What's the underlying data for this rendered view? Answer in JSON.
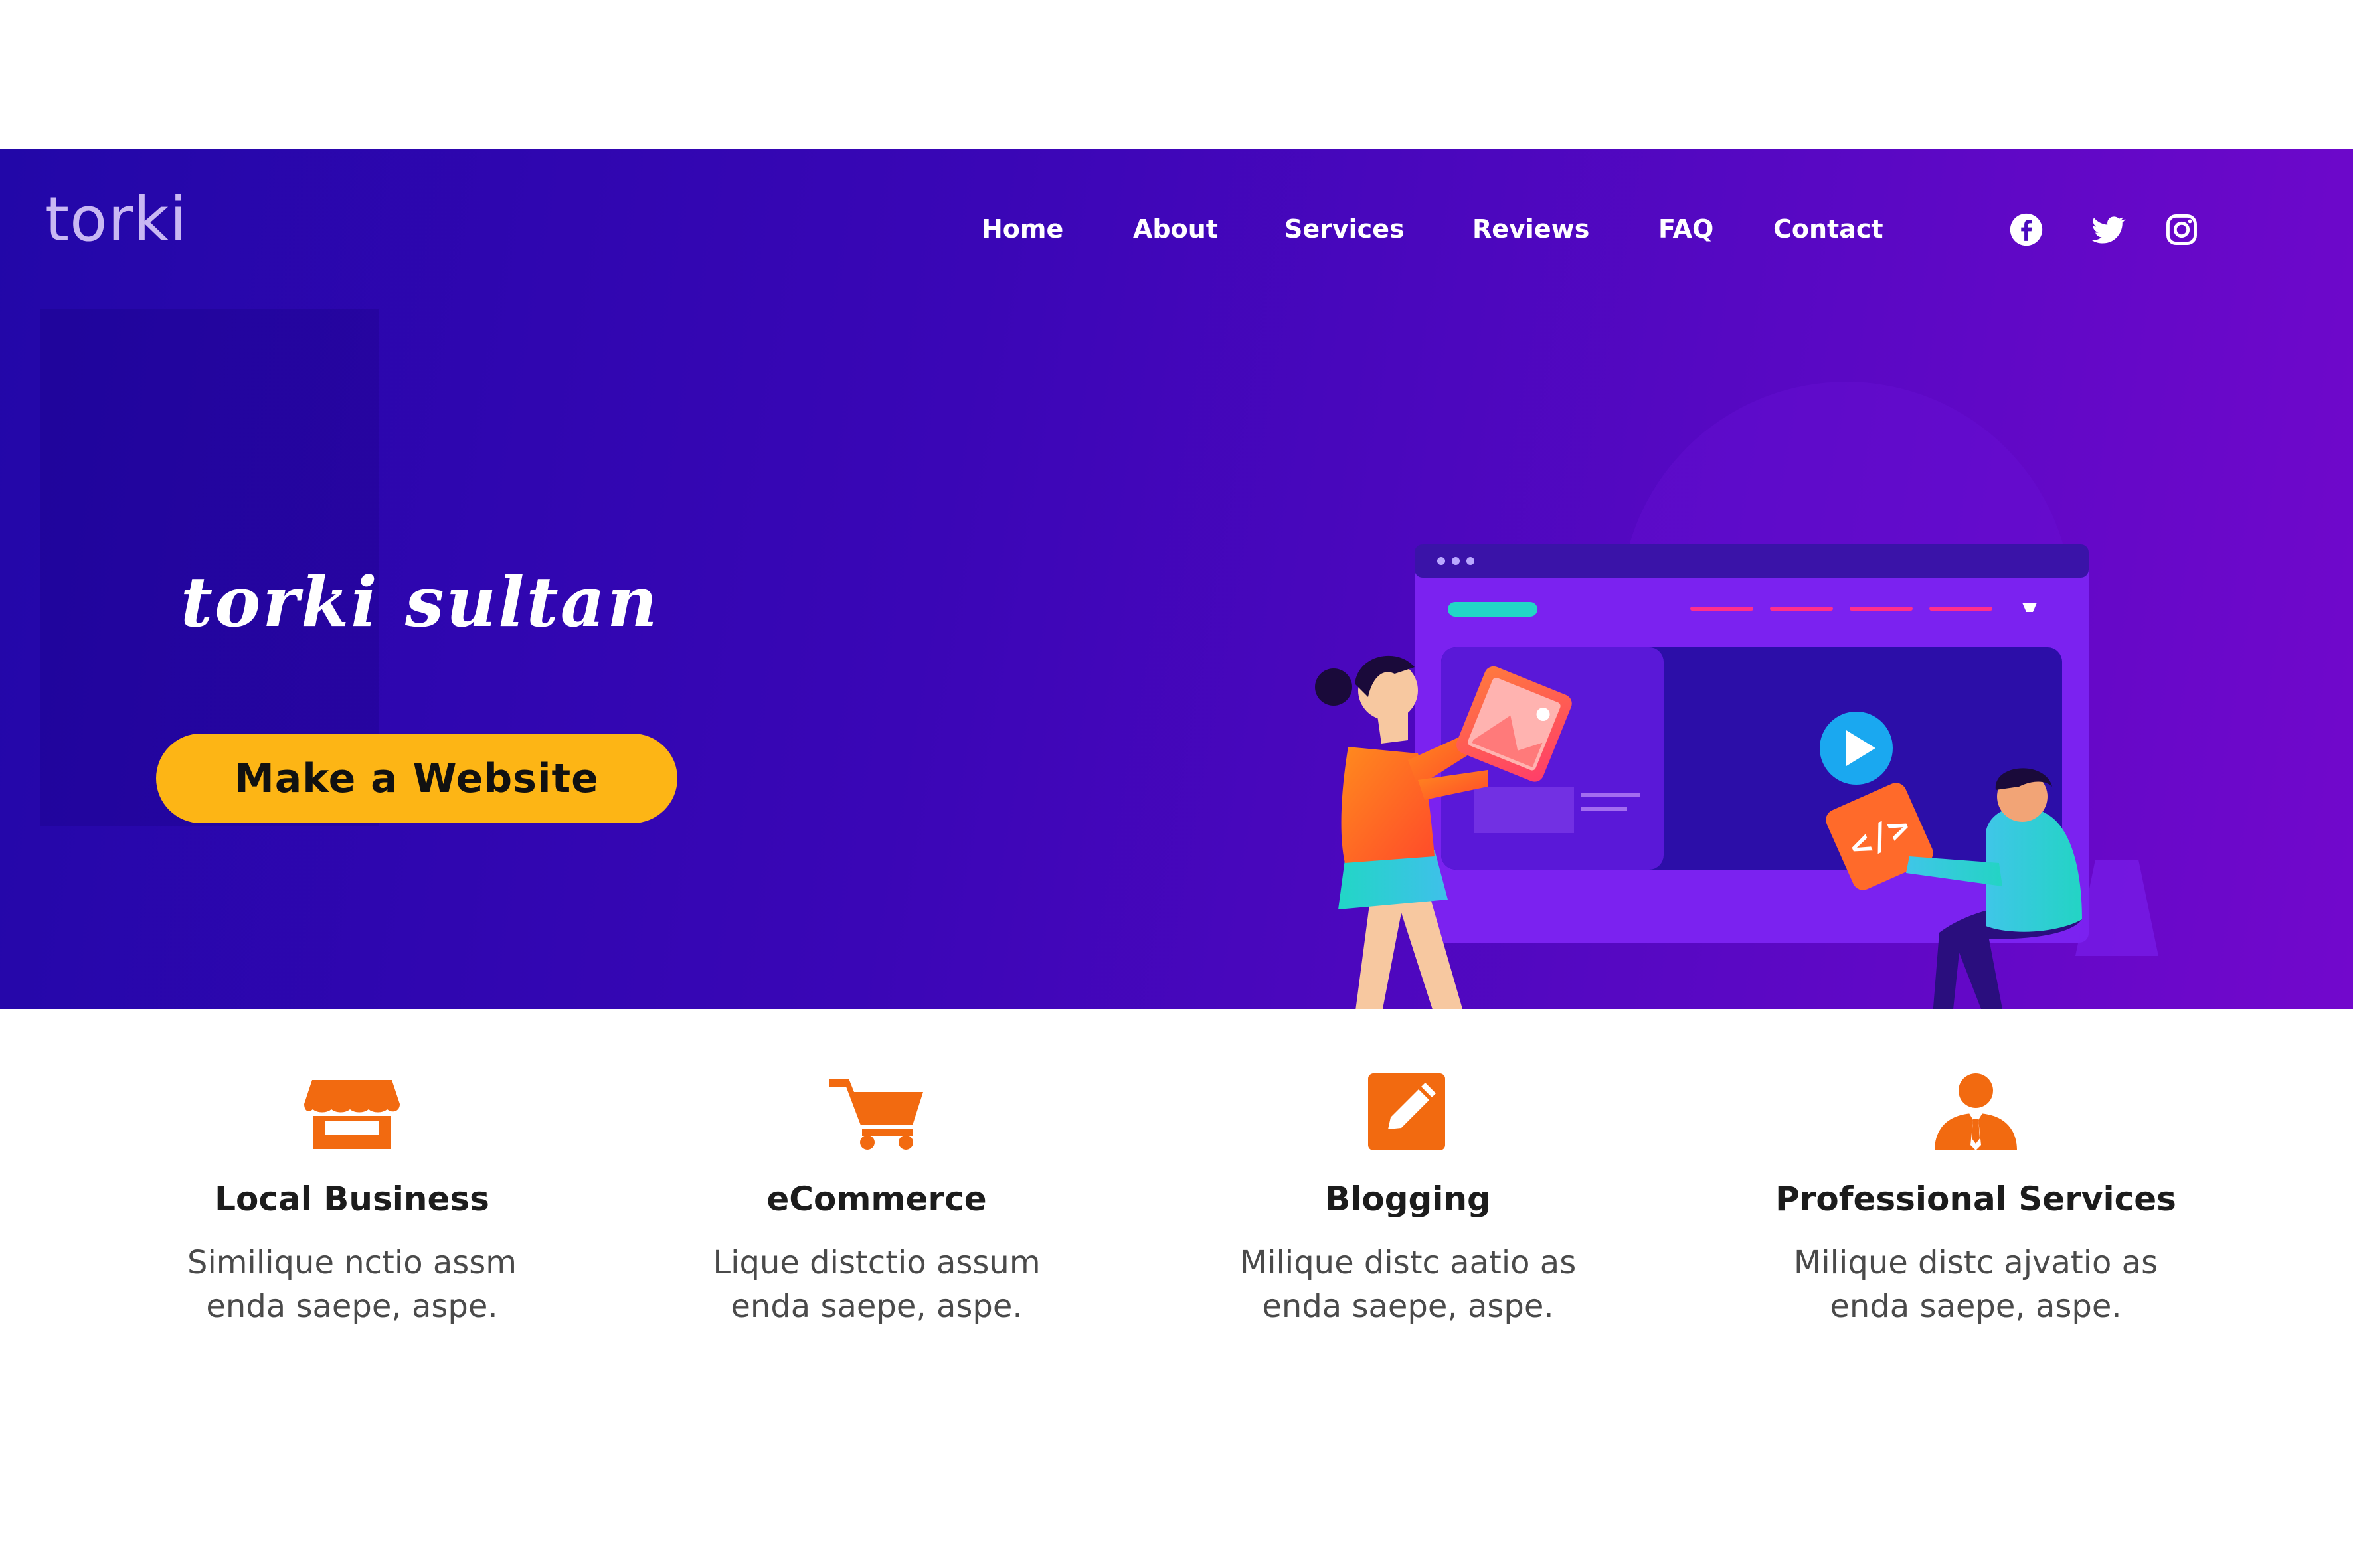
{
  "brand": {
    "logo_text": "torki"
  },
  "nav": {
    "items": [
      {
        "label": "Home"
      },
      {
        "label": "About"
      },
      {
        "label": "Services"
      },
      {
        "label": "Reviews"
      },
      {
        "label": "FAQ"
      },
      {
        "label": "Contact"
      }
    ],
    "social": [
      {
        "icon": "facebook-icon"
      },
      {
        "icon": "twitter-icon"
      },
      {
        "icon": "instagram-icon"
      }
    ]
  },
  "hero": {
    "name": "torki sultan",
    "cta_label": "Make a Website",
    "gradient_colors": [
      "#2207a8",
      "#7208cc"
    ],
    "cta_color": "#fdb515"
  },
  "features": [
    {
      "icon": "storefront-icon",
      "title": "Local Business",
      "desc_line1": "Similique nctio assm",
      "desc_line2": "enda saepe, aspe."
    },
    {
      "icon": "shopping-cart-icon",
      "title": "eCommerce",
      "desc_line1": "Lique distctio assum",
      "desc_line2": "enda saepe, aspe."
    },
    {
      "icon": "pencil-square-icon",
      "title": "Blogging",
      "desc_line1": "Milique distc aatio as",
      "desc_line2": "enda saepe, aspe."
    },
    {
      "icon": "professional-person-icon",
      "title": "Professional Services",
      "desc_line1": "Milique distc ajvatio as",
      "desc_line2": "enda saepe, aspe."
    }
  ],
  "colors": {
    "accent_orange": "#f26a10",
    "text_dark": "#1c1c1c",
    "text_muted": "#4a4a4a"
  }
}
